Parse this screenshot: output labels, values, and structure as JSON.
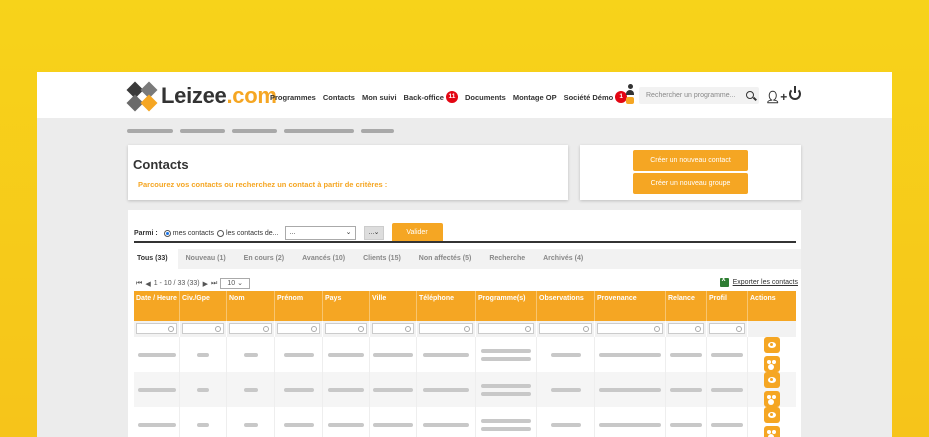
{
  "logo": {
    "name": "Leizee",
    "domain": ".com"
  },
  "nav": {
    "items": [
      {
        "label": "Programmes"
      },
      {
        "label": "Contacts"
      },
      {
        "label": "Mon suivi"
      },
      {
        "label": "Back-office",
        "badge": "11"
      },
      {
        "label": "Documents"
      },
      {
        "label": "Montage OP"
      },
      {
        "label": "Société Démo",
        "badge": "1"
      }
    ]
  },
  "search": {
    "placeholder": "Rechercher un programme..."
  },
  "page": {
    "title": "Contacts",
    "subtitle": "Parcourez vos contacts ou recherchez un contact à partir de critères :"
  },
  "actions": {
    "new_contact": "Créer un nouveau contact",
    "new_group": "Créer un nouveau groupe"
  },
  "filter": {
    "label": "Parmi :",
    "option_mine": "mes contacts",
    "option_others": "les contacts de...",
    "select_value": "...",
    "select2_value": "...",
    "submit": "Valider"
  },
  "tabs": [
    {
      "label": "Tous (33)",
      "active": true
    },
    {
      "label": "Nouveau (1)"
    },
    {
      "label": "En cours (2)"
    },
    {
      "label": "Avancés (10)"
    },
    {
      "label": "Clients (15)"
    },
    {
      "label": "Non affectés (5)"
    },
    {
      "label": "Recherche"
    },
    {
      "label": "Archivés (4)"
    }
  ],
  "pager": {
    "range": "1 - 10 / 33 (33)",
    "per_page": "10"
  },
  "export_label": "Exporter les contacts",
  "table": {
    "columns": [
      {
        "label": "Date / Heure"
      },
      {
        "label": "Civ./Gpe"
      },
      {
        "label": "Nom"
      },
      {
        "label": "Prénom"
      },
      {
        "label": "Pays"
      },
      {
        "label": "Ville"
      },
      {
        "label": "Téléphone"
      },
      {
        "label": "Programme(s)"
      },
      {
        "label": "Observations"
      },
      {
        "label": "Provenance"
      },
      {
        "label": "Relance"
      },
      {
        "label": "Profil"
      },
      {
        "label": "Actions"
      }
    ]
  },
  "colors": {
    "accent": "#f5a623",
    "badge": "#e30613",
    "background": "#f7d31a"
  },
  "icons": [
    "search-icon",
    "add-user-icon",
    "power-icon",
    "user-icon",
    "excel-icon",
    "view-icon",
    "group-icon"
  ]
}
